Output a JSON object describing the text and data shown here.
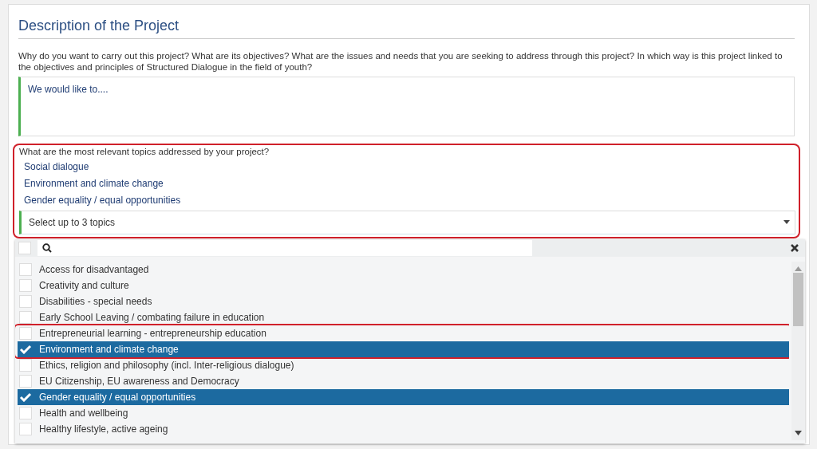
{
  "section": {
    "title": "Description of the Project"
  },
  "question": {
    "text": "Why do you want to carry out this project? What are its objectives? What are the issues and needs that you are seeking to address through this project? In which way is this project linked to the objectives and principles of Structured Dialogue in the field of youth?",
    "answer": "We would like to...."
  },
  "topics": {
    "highlighted": true,
    "label": "What are the most relevant topics addressed by your project?",
    "chosen": [
      "Social dialogue",
      "Environment and climate change",
      "Gender equality / equal opportunities"
    ],
    "select": {
      "placeholder": "Select up to 3 topics",
      "expanded": true
    }
  },
  "dropdown": {
    "select_all_checked": false,
    "options": [
      {
        "label": "Access for disadvantaged",
        "selected": false,
        "highlighted": false
      },
      {
        "label": "Creativity and culture",
        "selected": false,
        "highlighted": false
      },
      {
        "label": "Disabilities - special needs",
        "selected": false,
        "highlighted": false
      },
      {
        "label": "Early School Leaving / combating failure in education",
        "selected": false,
        "highlighted": false
      },
      {
        "label": "Entrepreneurial learning - entrepreneurship education",
        "selected": false,
        "highlighted": true
      },
      {
        "label": "Environment and climate change",
        "selected": true,
        "highlighted": true
      },
      {
        "label": "Ethics, religion and philosophy (incl. Inter-religious dialogue)",
        "selected": false,
        "highlighted": false
      },
      {
        "label": "EU Citizenship, EU awareness and Democracy",
        "selected": false,
        "highlighted": false
      },
      {
        "label": "Gender equality / equal opportunities",
        "selected": true,
        "highlighted": false
      },
      {
        "label": "Health and wellbeing",
        "selected": false,
        "highlighted": false
      },
      {
        "label": "Healthy lifestyle, active ageing",
        "selected": false,
        "highlighted": false
      }
    ]
  }
}
